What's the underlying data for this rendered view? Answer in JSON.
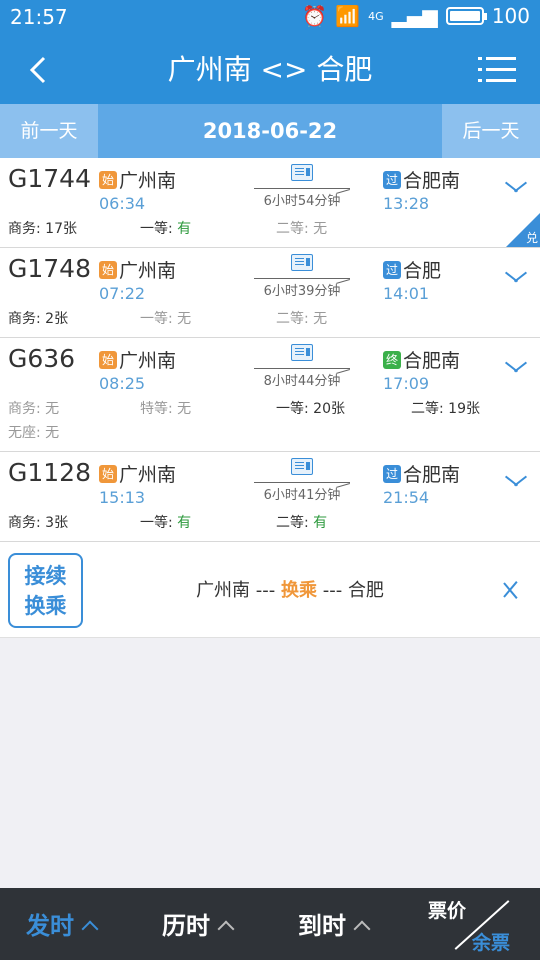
{
  "status": {
    "time": "21:57",
    "battery": "100",
    "network": "4G"
  },
  "header": {
    "title": "广州南 <> 合肥"
  },
  "date_bar": {
    "prev": "前一天",
    "date": "2018-06-22",
    "next": "后一天"
  },
  "trains": [
    {
      "no": "G1744",
      "from_badge": "始",
      "from": "广州南",
      "dep": "06:34",
      "duration": "6小时54分钟",
      "to_badge": "过",
      "to": "合肥南",
      "arr": "13:28",
      "seats": [
        {
          "label": "商务: ",
          "value": "17张"
        },
        {
          "label": "一等: ",
          "value": "有"
        },
        {
          "label": "二等: ",
          "value": "无"
        }
      ],
      "exchange": "兑"
    },
    {
      "no": "G1748",
      "from_badge": "始",
      "from": "广州南",
      "dep": "07:22",
      "duration": "6小时39分钟",
      "to_badge": "过",
      "to": "合肥",
      "arr": "14:01",
      "seats": [
        {
          "label": "商务: ",
          "value": "2张"
        },
        {
          "label": "一等: ",
          "value": "无"
        },
        {
          "label": "二等: ",
          "value": "无"
        }
      ]
    },
    {
      "no": "G636",
      "from_badge": "始",
      "from": "广州南",
      "dep": "08:25",
      "duration": "8小时44分钟",
      "to_badge": "终",
      "to": "合肥南",
      "arr": "17:09",
      "seats": [
        {
          "label": "商务: ",
          "value": "无"
        },
        {
          "label": "特等: ",
          "value": "无"
        },
        {
          "label": "一等: ",
          "value": "20张"
        },
        {
          "label": "二等: ",
          "value": "19张"
        },
        {
          "label": "无座: ",
          "value": "无"
        }
      ]
    },
    {
      "no": "G1128",
      "from_badge": "始",
      "from": "广州南",
      "dep": "15:13",
      "duration": "6小时41分钟",
      "to_badge": "过",
      "to": "合肥南",
      "arr": "21:54",
      "seats": [
        {
          "label": "商务: ",
          "value": "3张"
        },
        {
          "label": "一等: ",
          "value": "有"
        },
        {
          "label": "二等: ",
          "value": "有"
        }
      ]
    }
  ],
  "transfer": {
    "btn_line1": "接续",
    "btn_line2": "换乘",
    "from": "广州南",
    "sep1": " --- ",
    "mid": "换乘",
    "sep2": " --- ",
    "to": "合肥"
  },
  "bottom": {
    "depart": "发时",
    "duration": "历时",
    "arrive": "到时",
    "price": "票价",
    "remaining": "余票"
  }
}
